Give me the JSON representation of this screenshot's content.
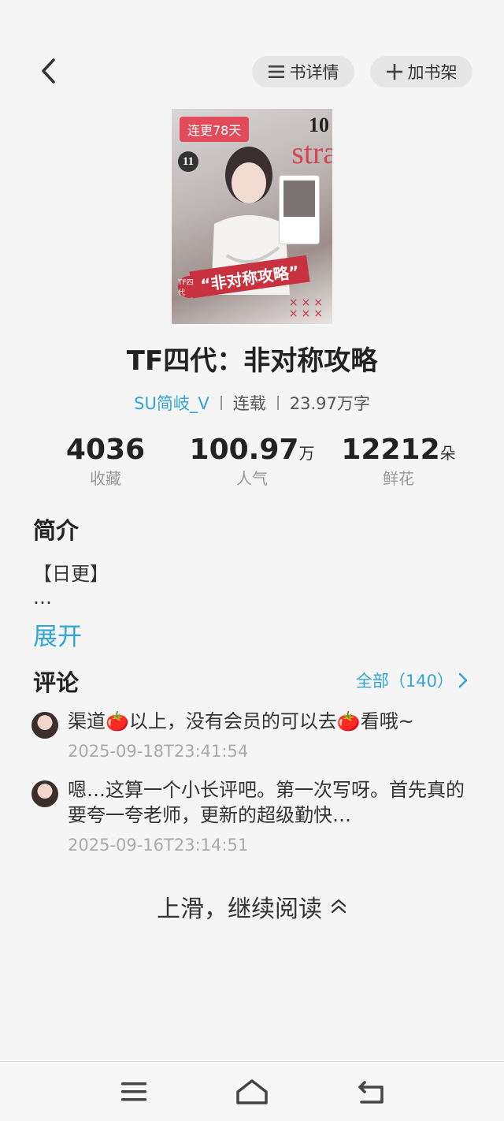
{
  "header": {
    "detail_label": "书详情",
    "shelf_label": "加书架"
  },
  "cover": {
    "badge": "连更78天",
    "num_top": "10",
    "num_left": "11",
    "script_text": "stra",
    "strip_text": "“非对称攻略”",
    "tag_text": "TF四代"
  },
  "book": {
    "title": "TF四代：非对称攻略",
    "author": "SU简岐_V",
    "status": "连载",
    "words": "23.97万字"
  },
  "stats": [
    {
      "value": "4036",
      "unit": "",
      "label": "收藏"
    },
    {
      "value": "100.97",
      "unit": "万",
      "label": "人气"
    },
    {
      "value": "12212",
      "unit": "朵",
      "label": "鲜花"
    }
  ],
  "intro": {
    "heading": "简介",
    "line1": "【日更】",
    "line2": "…",
    "expand_label": "展开"
  },
  "comments": {
    "heading": "评论",
    "all_label": "全部（140）",
    "items": [
      {
        "text": "渠道🍅以上，没有会员的可以去🍅看哦~",
        "time": "2025-09-18T23:41:54"
      },
      {
        "text": "嗯…这算一个小长评吧。第一次写呀。首先真的要夸一夸老师，更新的超级勤快…",
        "time": "2025-09-16T23:14:51"
      }
    ]
  },
  "continue_label": "上滑，继续阅读",
  "icons": {
    "back": "back-chevron-icon",
    "detail": "list-icon",
    "shelf": "plus-icon",
    "menu": "menu-icon",
    "home": "home-icon",
    "return": "return-icon",
    "up": "double-chevron-up-icon"
  },
  "colors": {
    "accent": "#2fa6d6",
    "badge": "#e14b5a",
    "background": "#f5f5f5"
  }
}
